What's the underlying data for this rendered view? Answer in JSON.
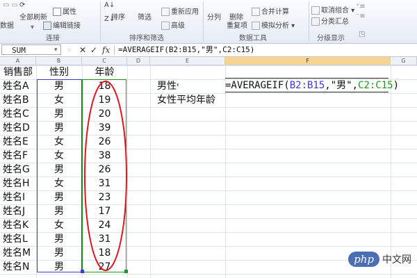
{
  "ribbon": {
    "buttons": {
      "refresh_all": "全部刷新",
      "data_short": "数据",
      "properties": "属性",
      "edit_links": "编辑链接",
      "sort": "排序",
      "filter": "筛选",
      "reapply": "重新应用",
      "advanced": "高级",
      "split": "分列",
      "remove_dup_1": "删除",
      "remove_dup_2": "重复项",
      "consolidate": "合并计算",
      "what_if": "模拟分析",
      "ungroup": "取消组合",
      "subtotal": "分类汇总"
    },
    "groups": {
      "connections": "连接",
      "sort_filter": "排序和筛选",
      "data_tools": "数据工具",
      "outline": "分级显示"
    }
  },
  "formula_bar": {
    "name_box": "SUM",
    "formula": "=AVERAGEIF(B2:B15,\"男\",C2:C15)"
  },
  "columns": [
    "A",
    "B",
    "C",
    "D",
    "E",
    "F",
    "G"
  ],
  "headers": {
    "a": "销售部",
    "b": "性别",
    "c": "年龄"
  },
  "rows": [
    {
      "name": "姓名A",
      "gender": "男",
      "age": "18"
    },
    {
      "name": "姓名B",
      "gender": "女",
      "age": "19"
    },
    {
      "name": "姓名C",
      "gender": "男",
      "age": "20"
    },
    {
      "name": "姓名D",
      "gender": "男",
      "age": "39"
    },
    {
      "name": "姓名E",
      "gender": "女",
      "age": "26"
    },
    {
      "name": "姓名F",
      "gender": "女",
      "age": "38"
    },
    {
      "name": "姓名G",
      "gender": "男",
      "age": "26"
    },
    {
      "name": "姓名H",
      "gender": "女",
      "age": "31"
    },
    {
      "name": "姓名I",
      "gender": "男",
      "age": "23"
    },
    {
      "name": "姓名J",
      "gender": "男",
      "age": "17"
    },
    {
      "name": "姓名K",
      "gender": "女",
      "age": "24"
    },
    {
      "name": "姓名L",
      "gender": "男",
      "age": "31"
    },
    {
      "name": "姓名M",
      "gender": "男",
      "age": "18"
    },
    {
      "name": "姓名N",
      "gender": "男",
      "age": "27"
    }
  ],
  "side_labels": {
    "male": "男性",
    "female": "女性平均年龄"
  },
  "editing_cell": {
    "prefix": "=AVERAGEIF(",
    "ref1": "B2:B15",
    "middle": ",\"男\",",
    "ref2": "C2:C15",
    "suffix": ")"
  },
  "colors": {
    "ref1": "#3a3ad0",
    "ref2": "#1a9a1a",
    "ellipse": "#e0141e",
    "selected_header": "#f7d58f"
  },
  "watermark": {
    "brand": "php",
    "suffix": "中文网"
  }
}
